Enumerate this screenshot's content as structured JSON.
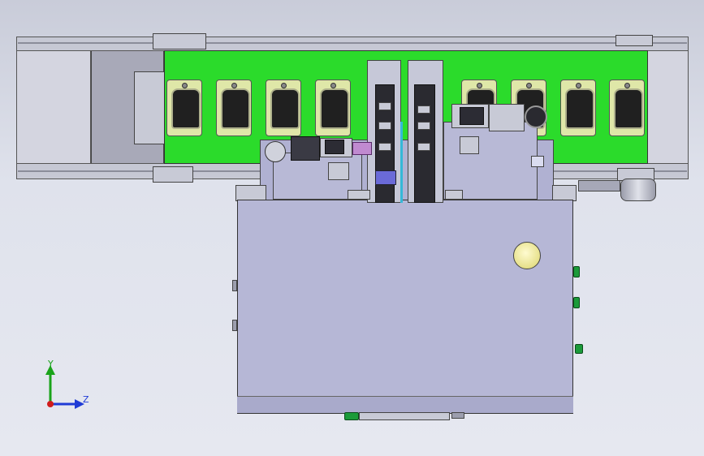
{
  "viewport": {
    "background": "#dfe2ec",
    "belt_color": "#2bdb2b",
    "box_color": "#b6b7d6",
    "pocket_color": "#dfe7a8",
    "pocket_count": 10
  },
  "triad": {
    "y_label": "Y",
    "z_label": "Z",
    "y_color": "#1aa31a",
    "z_color": "#1f3bd6",
    "x_color": "#d01c1c"
  }
}
